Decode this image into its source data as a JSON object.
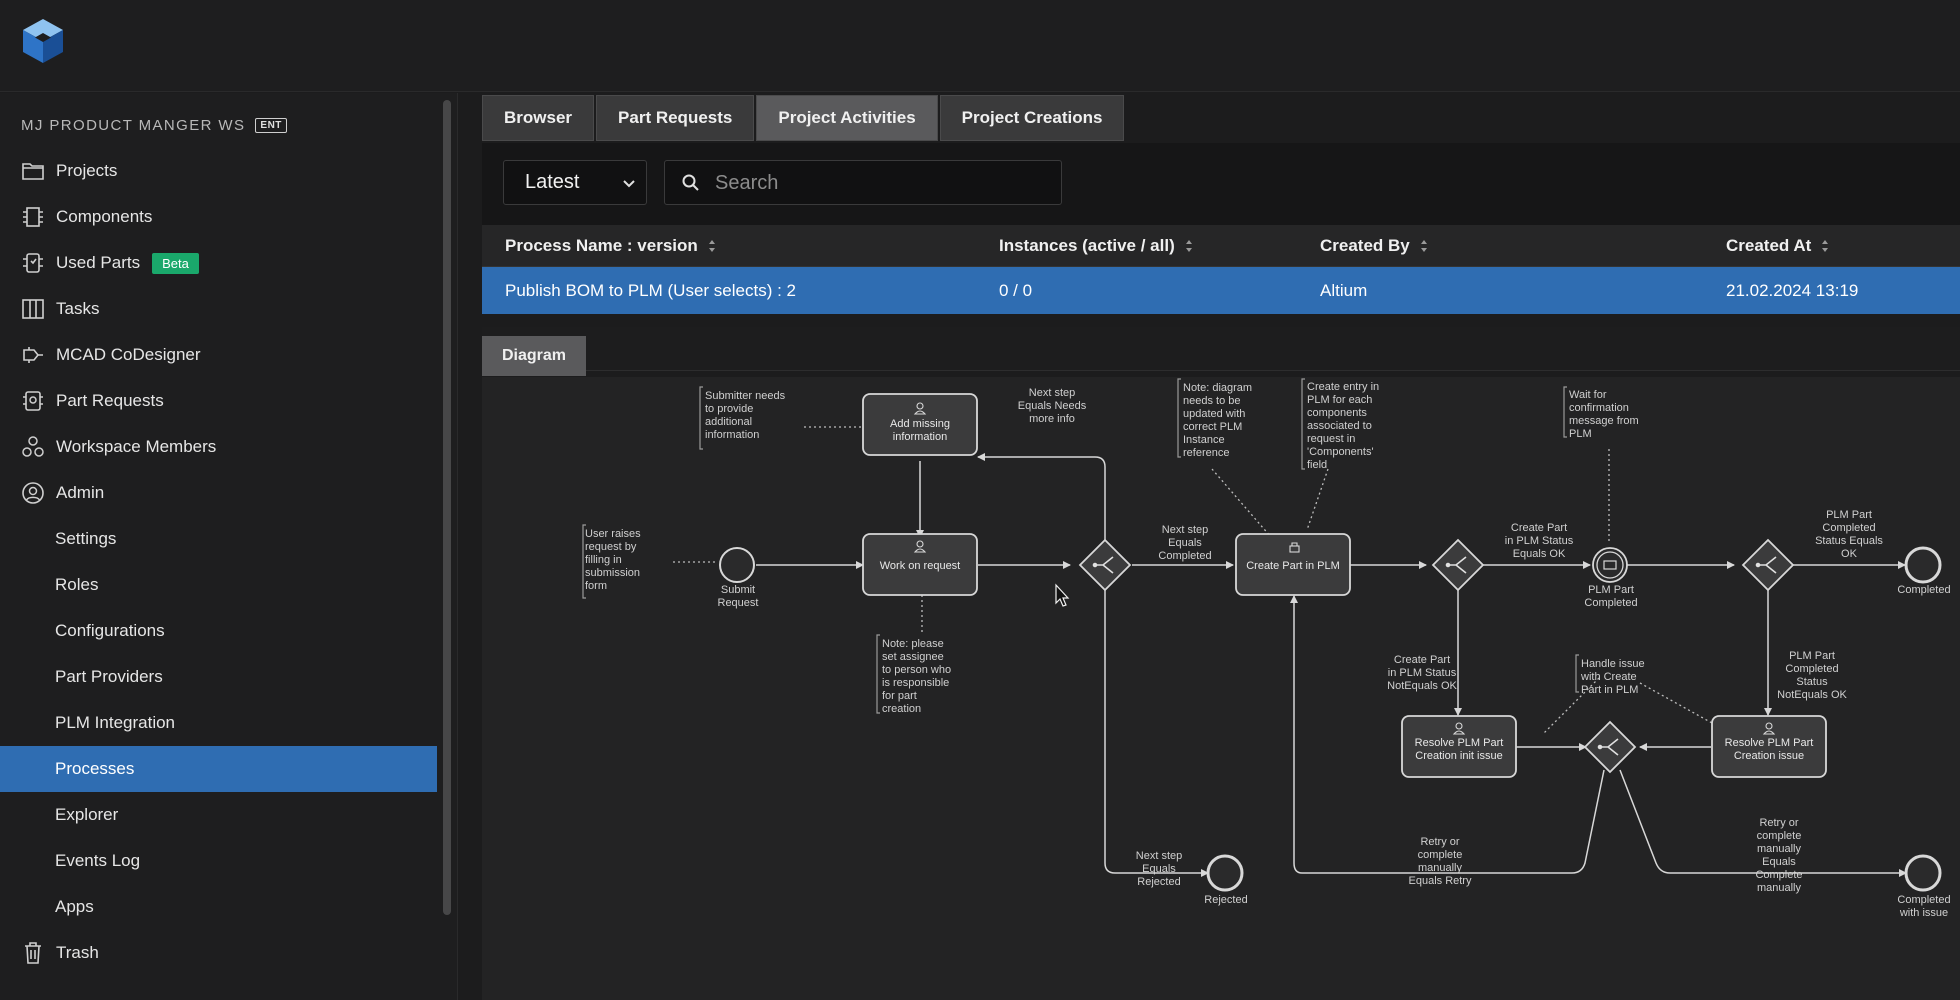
{
  "app": {
    "logo_icon": "cube-logo-icon",
    "workspace_name": "MJ PRODUCT MANGER WS",
    "workspace_badge": "ENT"
  },
  "sidebar": {
    "items": [
      {
        "label": "Projects",
        "icon": "folder-icon"
      },
      {
        "label": "Components",
        "icon": "chip-icon"
      },
      {
        "label": "Used Parts",
        "icon": "used-parts-icon",
        "badge": "Beta"
      },
      {
        "label": "Tasks",
        "icon": "board-icon"
      },
      {
        "label": "MCAD CoDesigner",
        "icon": "mcad-icon"
      },
      {
        "label": "Part Requests",
        "icon": "part-request-icon"
      },
      {
        "label": "Workspace Members",
        "icon": "members-icon"
      },
      {
        "label": "Admin",
        "icon": "user-circle-icon"
      }
    ],
    "admin_items": [
      "Settings",
      "Roles",
      "Configurations",
      "Part Providers",
      "PLM Integration",
      "Processes",
      "Explorer",
      "Events Log",
      "Apps"
    ],
    "active_item": "Processes",
    "trash": {
      "label": "Trash",
      "icon": "trash-icon"
    }
  },
  "tabs": [
    "Browser",
    "Part Requests",
    "Project Activities",
    "Project Creations"
  ],
  "active_tab": "Project Activities",
  "toolbar": {
    "version_select": "Latest",
    "search_placeholder": "Search"
  },
  "table": {
    "columns": [
      "Process Name : version",
      "Instances (active / all)",
      "Created By",
      "Created At"
    ],
    "rows": [
      [
        "Publish BOM to PLM (User selects) : 2",
        "0 / 0",
        "Altium",
        "21.02.2024 13:19"
      ]
    ]
  },
  "diagram": {
    "tab_label": "Diagram",
    "tasks": {
      "add_info": [
        "Add missing",
        "information"
      ],
      "work": [
        "Work on request"
      ],
      "create": [
        "Create Part in PLM"
      ],
      "resolve_init": [
        "Resolve PLM Part",
        "Creation init issue"
      ],
      "resolve_issue": [
        "Resolve PLM Part",
        "Creation issue"
      ]
    },
    "events": {
      "submit": [
        "Submit",
        "Request"
      ],
      "rejected": [
        "Rejected"
      ],
      "plm_completed": [
        "PLM Part",
        "Completed"
      ],
      "completed": [
        "Completed"
      ],
      "completed_issue": [
        "Completed",
        "with issue"
      ]
    },
    "notes": {
      "submitter": [
        "Submitter needs",
        "to provide",
        "additional",
        "information"
      ],
      "user_raises": [
        "User raises",
        "request by",
        "filling in",
        "submission",
        "form"
      ],
      "assignee": [
        "Note: please",
        "set assignee",
        "to person who",
        "is responsible",
        "for part",
        "creation"
      ],
      "diagram_update": [
        "Note: diagram",
        "needs to be",
        "updated with",
        "correct PLM",
        "Instance",
        "reference"
      ],
      "create_entry": [
        "Create entry in",
        "PLM for each",
        "components",
        "associated to",
        "request in",
        "'Components'",
        "field"
      ],
      "wait": [
        "Wait for",
        "confirmation",
        "message from",
        "PLM"
      ],
      "handle": [
        "Handle issue",
        "with Create",
        "Part in PLM"
      ]
    },
    "flow_labels": {
      "needs_more_info": [
        "Next step",
        "Equals Needs",
        "more info"
      ],
      "completed": [
        "Next step",
        "Equals",
        "Completed"
      ],
      "status_ok": [
        "Create Part",
        "in PLM Status",
        "Equals OK"
      ],
      "plm_completed_ok": [
        "PLM Part",
        "Completed",
        "Status Equals",
        "OK"
      ],
      "status_not_ok": [
        "Create Part",
        "in PLM Status",
        "NotEquals OK"
      ],
      "plm_completed_not_ok": [
        "PLM Part",
        "Completed",
        "Status",
        "NotEquals OK"
      ],
      "rejected": [
        "Next step",
        "Equals",
        "Rejected"
      ],
      "retry": [
        "Retry or",
        "complete",
        "manually",
        "Equals Retry"
      ],
      "complete_manually": [
        "Retry or",
        "complete",
        "manually",
        "Equals",
        "Complete",
        "manually"
      ]
    }
  }
}
